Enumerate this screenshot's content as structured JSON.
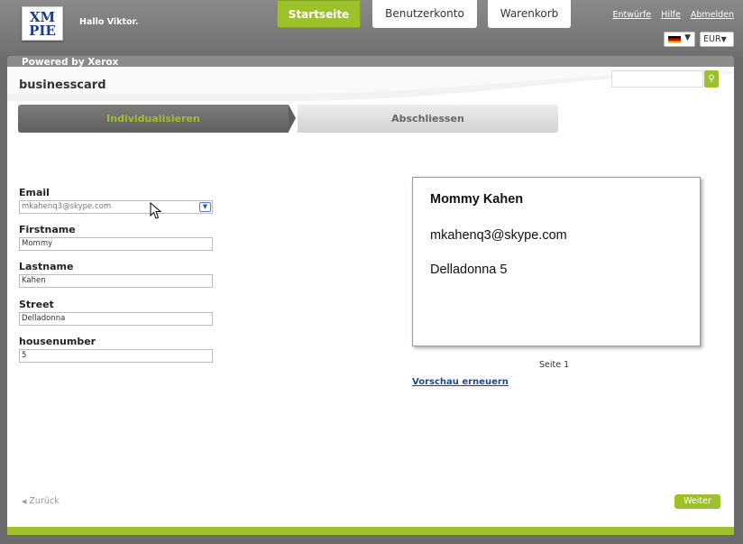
{
  "header": {
    "logo_lines": [
      "XM",
      "PIE"
    ],
    "greeting": "Hallo Viktor.",
    "nav_tabs": [
      "Startseite",
      "Benutzerkonto",
      "Warenkorb"
    ],
    "links": [
      "Entwürfe",
      "Hilfe",
      "Abmelden"
    ],
    "currency": "EUR",
    "language_flag": "german-flag-icon"
  },
  "panel": {
    "powered_by": "Powered by Xerox",
    "page_title": "businesscard",
    "search_placeholder": ""
  },
  "steps": {
    "active": "Individualisieren",
    "next": "Abschliessen"
  },
  "form": {
    "email_label": "Email",
    "email_value": "mkahenq3@skype.com",
    "firstname_label": "Firstname",
    "firstname_value": "Mommy",
    "lastname_label": "Lastname",
    "lastname_value": "Kahen",
    "street_label": "Street",
    "street_value": "Delladonna",
    "housenumber_label": "housenumber",
    "housenumber_value": "5"
  },
  "preview": {
    "name": "Mommy Kahen",
    "email": "mkahenq3@skype.com",
    "address": "Delladonna 5",
    "page_label": "Seite 1",
    "refresh_link": "Vorschau erneuern"
  },
  "nav": {
    "back": "Zurück",
    "next": "Weiter"
  },
  "colors": {
    "accent": "#9dc12b",
    "header_gray": "#7a7a7a",
    "link_blue": "#1a4a8a"
  }
}
